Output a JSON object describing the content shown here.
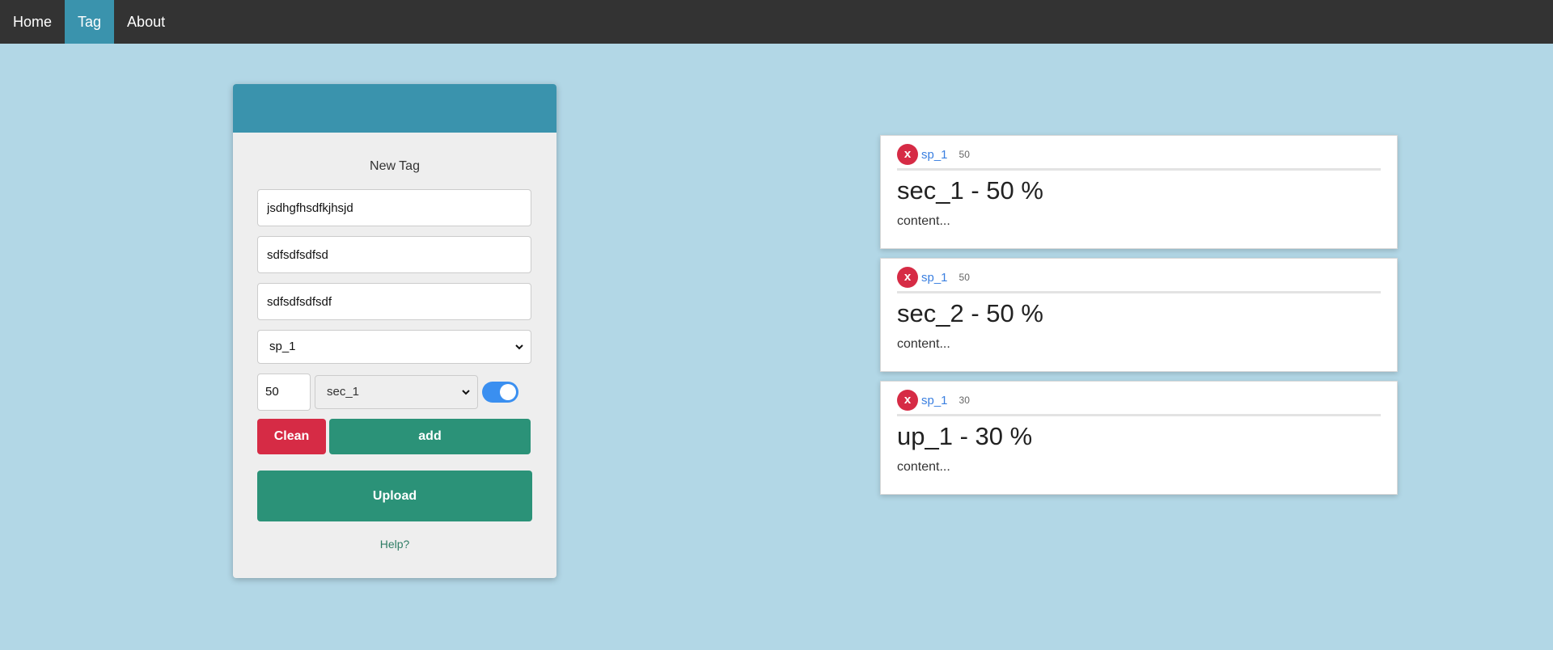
{
  "nav": {
    "items": [
      {
        "label": "Home",
        "active": false
      },
      {
        "label": "Tag",
        "active": true
      },
      {
        "label": "About",
        "active": false
      }
    ]
  },
  "form": {
    "title": "New Tag",
    "field1": "jsdhgfhsdfkjhsjd",
    "field2": "sdfsdfsdfsd",
    "field3": "sdfsdfsdfsdf",
    "sp_select": "sp_1",
    "percent": "50",
    "section_select": "sec_1",
    "toggle_on": true,
    "clean_label": "Clean",
    "add_label": "add",
    "upload_label": "Upload",
    "help_label": "Help?"
  },
  "tags": [
    {
      "sp": "sp_1",
      "num": "50",
      "title": "sec_1 - 50 %",
      "content": "content...",
      "delete_label": "x"
    },
    {
      "sp": "sp_1",
      "num": "50",
      "title": "sec_2 - 50 %",
      "content": "content...",
      "delete_label": "x"
    },
    {
      "sp": "sp_1",
      "num": "30",
      "title": "up_1 - 30 %",
      "content": "content...",
      "delete_label": "x"
    }
  ],
  "colors": {
    "background": "#b2d7e6",
    "nav": "#333333",
    "accent": "#3a93ad",
    "danger": "#d62b45",
    "success": "#2b9278",
    "toggle": "#3a8ff0"
  }
}
